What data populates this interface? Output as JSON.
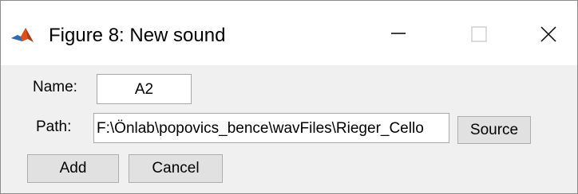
{
  "window": {
    "title": "Figure 8: New sound",
    "app_icon": "matlab-logo-icon",
    "controls": {
      "minimize_icon": "minimize-icon",
      "maximize_icon": "maximize-icon",
      "close_icon": "close-icon"
    }
  },
  "form": {
    "name_label": "Name:",
    "name_value": "A2",
    "path_label": "Path:",
    "path_value": "F:\\Önlab\\popovics_bence\\wavFiles\\Rieger_Cello",
    "source_button": "Source",
    "add_button": "Add",
    "cancel_button": "Cancel"
  },
  "colors": {
    "titlebar_bg": "#ffffff",
    "client_bg": "#f0f0f0",
    "button_bg": "#e1e1e1",
    "button_border": "#adadad"
  }
}
